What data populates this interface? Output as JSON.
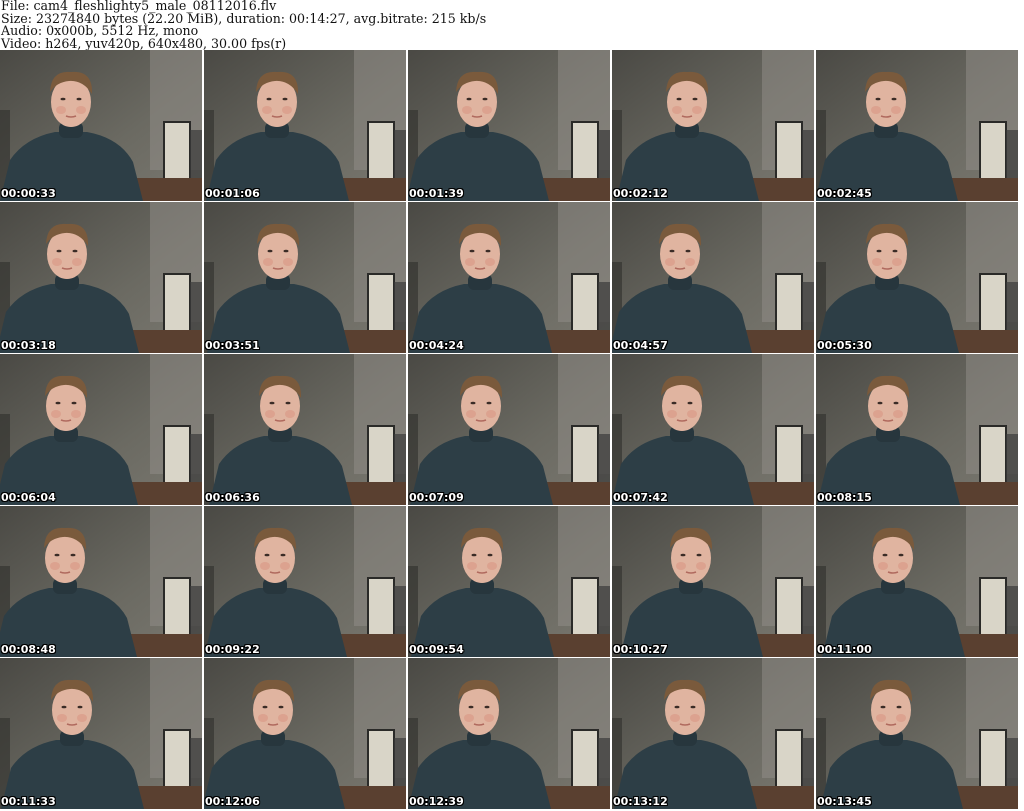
{
  "header": {
    "file_line": "File: cam4_fleshlighty5_male_08112016.flv",
    "size_line": "Size: 23274840 bytes (22.20 MiB), duration: 00:14:27, avg.bitrate: 215 kb/s",
    "audio_line": "Audio: 0x000b, 5512 Hz, mono",
    "video_line": "Video: h264, yuv420p, 640x480, 30.00 fps(r)"
  },
  "colors": {
    "wall_top": "#6b6a62",
    "wall_bottom": "#4a4944",
    "door": "#8f8d87",
    "cabinet": "#d9d5c8",
    "floor": "#5a4030",
    "sweater": "#2d3e46",
    "skin": "#e0b4a0",
    "hair": "#7a5a3c"
  },
  "thumbnail_icon": "webcam-frame-image",
  "thumbnails": [
    {
      "timestamp": "00:00:33"
    },
    {
      "timestamp": "00:01:06"
    },
    {
      "timestamp": "00:01:39"
    },
    {
      "timestamp": "00:02:12"
    },
    {
      "timestamp": "00:02:45"
    },
    {
      "timestamp": "00:03:18"
    },
    {
      "timestamp": "00:03:51"
    },
    {
      "timestamp": "00:04:24"
    },
    {
      "timestamp": "00:04:57"
    },
    {
      "timestamp": "00:05:30"
    },
    {
      "timestamp": "00:06:04"
    },
    {
      "timestamp": "00:06:36"
    },
    {
      "timestamp": "00:07:09"
    },
    {
      "timestamp": "00:07:42"
    },
    {
      "timestamp": "00:08:15"
    },
    {
      "timestamp": "00:08:48"
    },
    {
      "timestamp": "00:09:22"
    },
    {
      "timestamp": "00:09:54"
    },
    {
      "timestamp": "00:10:27"
    },
    {
      "timestamp": "00:11:00"
    },
    {
      "timestamp": "00:11:33"
    },
    {
      "timestamp": "00:12:06"
    },
    {
      "timestamp": "00:12:39"
    },
    {
      "timestamp": "00:13:12"
    },
    {
      "timestamp": "00:13:45"
    }
  ]
}
